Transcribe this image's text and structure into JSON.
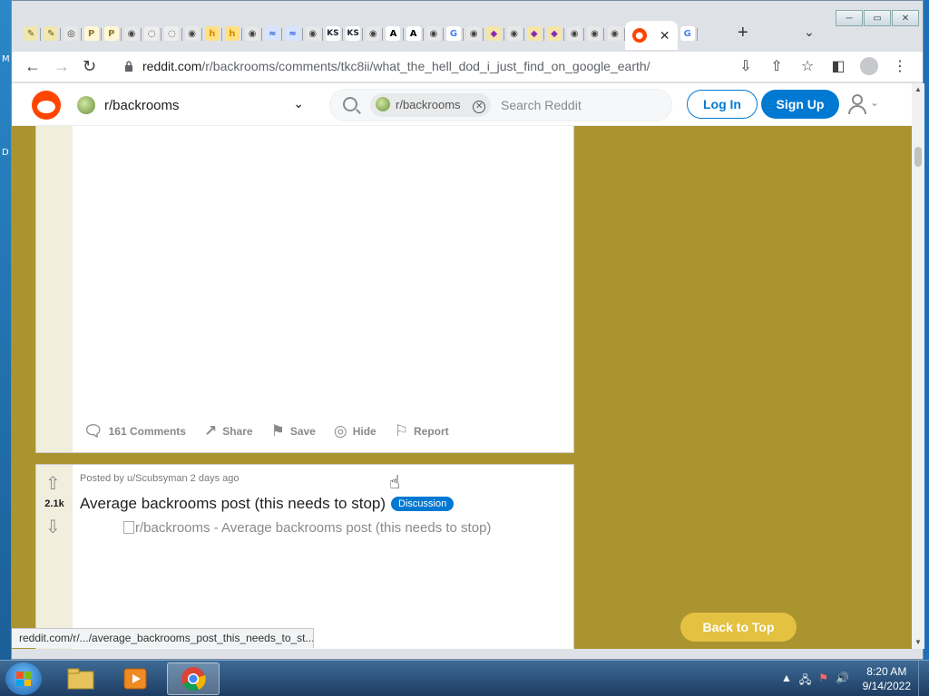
{
  "desktop": {
    "left_letters": [
      "M",
      "D"
    ]
  },
  "browser": {
    "window_controls": {
      "minimize": "─",
      "maximize": "▭",
      "close": "✕"
    },
    "tabs": [
      {
        "icon": "pen-icon",
        "glyph": "✎",
        "bg": "#f2e6b0",
        "fg": "#6a5a10"
      },
      {
        "icon": "pen-icon",
        "glyph": "✎",
        "bg": "#f2e6b0",
        "fg": "#6a5a10"
      },
      {
        "icon": "chrome-icon",
        "glyph": "◎",
        "bg": "#e8e8e8",
        "fg": "#333"
      },
      {
        "icon": "p-icon",
        "glyph": "P",
        "bg": "#fff7d6",
        "fg": "#8a7a30"
      },
      {
        "icon": "p-icon",
        "glyph": "P",
        "bg": "#fff7d6",
        "fg": "#8a7a30"
      },
      {
        "icon": "globe-icon",
        "glyph": "◉",
        "bg": "#e8e8e8",
        "fg": "#444"
      },
      {
        "icon": "spiral-icon",
        "glyph": "◌",
        "bg": "#eee",
        "fg": "#333"
      },
      {
        "icon": "spiral-icon",
        "glyph": "◌",
        "bg": "#eee",
        "fg": "#333"
      },
      {
        "icon": "globe-icon",
        "glyph": "◉",
        "bg": "#e8e8e8",
        "fg": "#444"
      },
      {
        "icon": "h-icon",
        "glyph": "h",
        "bg": "#ffe082",
        "fg": "#d68a00"
      },
      {
        "icon": "h-icon",
        "glyph": "h",
        "bg": "#ffe082",
        "fg": "#d68a00"
      },
      {
        "icon": "globe-icon",
        "glyph": "◉",
        "bg": "#e8e8e8",
        "fg": "#444"
      },
      {
        "icon": "stripe-icon",
        "glyph": "≈",
        "bg": "#d6e4ff",
        "fg": "#2a5bd7"
      },
      {
        "icon": "stripe-icon",
        "glyph": "≈",
        "bg": "#d6e4ff",
        "fg": "#2a5bd7"
      },
      {
        "icon": "globe-icon",
        "glyph": "◉",
        "bg": "#e8e8e8",
        "fg": "#444"
      },
      {
        "icon": "ks-icon",
        "glyph": "KS",
        "bg": "#fff",
        "fg": "#223"
      },
      {
        "icon": "ks-icon",
        "glyph": "KS",
        "bg": "#fff",
        "fg": "#223"
      },
      {
        "icon": "globe-icon",
        "glyph": "◉",
        "bg": "#e8e8e8",
        "fg": "#444"
      },
      {
        "icon": "a-icon",
        "glyph": "A",
        "bg": "#fff",
        "fg": "#000"
      },
      {
        "icon": "a-icon",
        "glyph": "A",
        "bg": "#fff",
        "fg": "#000"
      },
      {
        "icon": "globe-icon",
        "glyph": "◉",
        "bg": "#e8e8e8",
        "fg": "#444"
      },
      {
        "icon": "google-icon",
        "glyph": "G",
        "bg": "#fff",
        "fg": "#4285f4"
      },
      {
        "icon": "globe-icon",
        "glyph": "◉",
        "bg": "#e8e8e8",
        "fg": "#444"
      },
      {
        "icon": "diamond-icon",
        "glyph": "◆",
        "bg": "#f5e6a8",
        "fg": "#8a2bb0"
      },
      {
        "icon": "globe-icon",
        "glyph": "◉",
        "bg": "#e8e8e8",
        "fg": "#444"
      },
      {
        "icon": "diamond-icon",
        "glyph": "◆",
        "bg": "#f5e6a8",
        "fg": "#8a2bb0"
      },
      {
        "icon": "diamond-icon",
        "glyph": "◆",
        "bg": "#f5e6a8",
        "fg": "#8a2bb0"
      },
      {
        "icon": "globe-icon",
        "glyph": "◉",
        "bg": "#e8e8e8",
        "fg": "#444"
      },
      {
        "icon": "globe-icon",
        "glyph": "◉",
        "bg": "#e8e8e8",
        "fg": "#444"
      },
      {
        "icon": "globe-icon",
        "glyph": "◉",
        "bg": "#e8e8e8",
        "fg": "#444"
      }
    ],
    "active_tab": {
      "icon": "reddit-icon",
      "close": "✕"
    },
    "last_tab": {
      "icon": "google-icon",
      "glyph": "G"
    },
    "new_tab": "+",
    "tab_dropdown": "⌄",
    "url": {
      "host": "reddit.com",
      "path": "/r/backrooms/comments/tkc8ii/what_the_hell_dod_i_just_find_on_google_earth/"
    },
    "toolbar_icons": [
      "install-icon",
      "share-icon",
      "star-icon",
      "sidepanel-icon",
      "profile-icon",
      "menu-icon"
    ]
  },
  "reddit": {
    "community": "r/backrooms",
    "search": {
      "chip": "r/backrooms",
      "placeholder": "Search Reddit"
    },
    "login": "Log In",
    "signup": "Sign Up",
    "accent": "#0079d3",
    "page_bg": "#aa942f",
    "post1": {
      "actions": [
        {
          "name": "comments",
          "icon": "comment-icon",
          "glyph": "🗨",
          "label": "161 Comments"
        },
        {
          "name": "share",
          "icon": "share-icon",
          "glyph": "↗",
          "label": "Share"
        },
        {
          "name": "save",
          "icon": "bookmark-icon",
          "glyph": "⚑",
          "label": "Save"
        },
        {
          "name": "hide",
          "icon": "eye-off-icon",
          "glyph": "◎",
          "label": "Hide"
        },
        {
          "name": "report",
          "icon": "flag-icon",
          "glyph": "⚐",
          "label": "Report"
        }
      ]
    },
    "post2": {
      "score": "2.1k",
      "meta": "Posted by u/Scubsyman 2 days ago",
      "title": "Average backrooms post (this needs to stop)",
      "flair": "Discussion",
      "image_alt": "r/backrooms - Average backrooms post (this needs to stop)"
    },
    "back_to_top": "Back to Top"
  },
  "status_bar": "reddit.com/r/.../average_backrooms_post_this_needs_to_st...",
  "taskbar": {
    "items": [
      "explorer-icon",
      "media-player-icon",
      "chrome-icon"
    ],
    "time": "8:20 AM",
    "date": "9/14/2022"
  }
}
